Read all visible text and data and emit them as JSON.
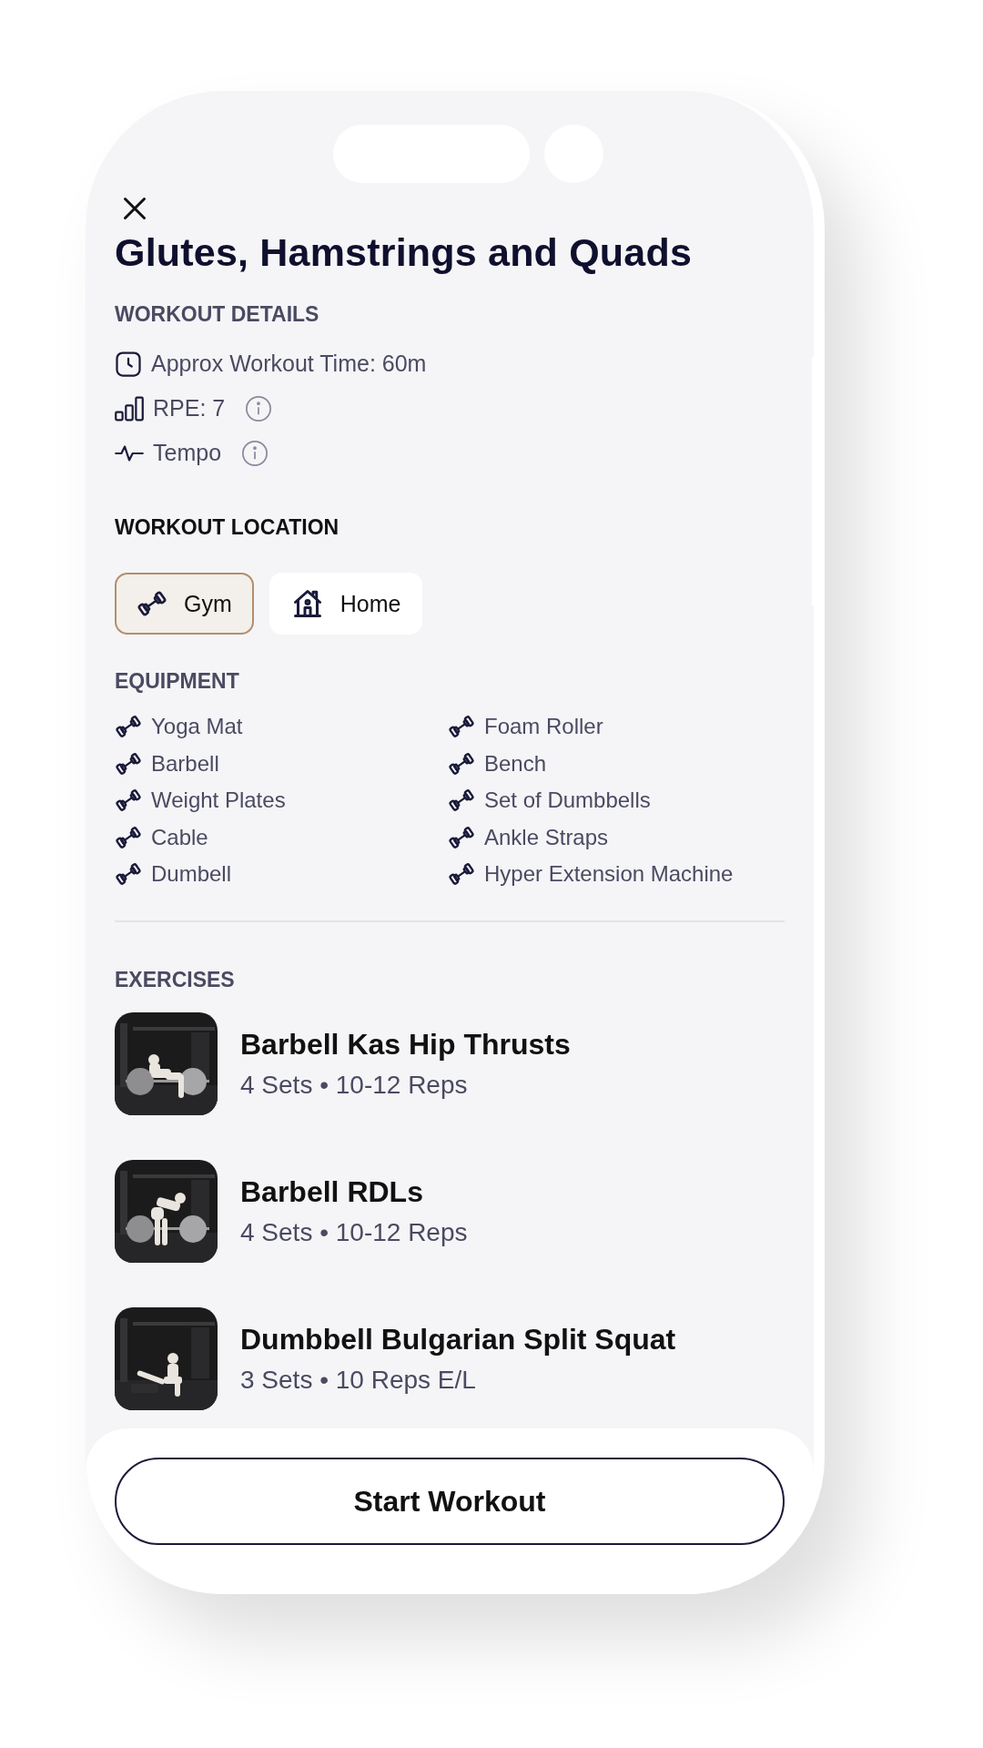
{
  "title": "Glutes, Hamstrings and Quads",
  "details": {
    "heading": "WORKOUT DETAILS",
    "items": [
      {
        "kind": "time",
        "text": "Approx Workout Time: 60m",
        "info": false
      },
      {
        "kind": "rpe",
        "text": "RPE: 7",
        "info": true
      },
      {
        "kind": "tempo",
        "text": "Tempo",
        "info": true
      }
    ]
  },
  "location": {
    "heading": "WORKOUT LOCATION",
    "options": [
      {
        "kind": "gym",
        "label": "Gym",
        "selected": true
      },
      {
        "kind": "home",
        "label": "Home",
        "selected": false
      }
    ]
  },
  "equipment": {
    "heading": "EQUIPMENT",
    "items": [
      "Yoga Mat",
      "Foam Roller",
      "Barbell",
      "Bench",
      "Weight Plates",
      "Set of Dumbbells",
      "Cable",
      "Ankle Straps",
      "Dumbell",
      "Hyper Extension Machine"
    ]
  },
  "exercises": {
    "heading": "EXERCISES",
    "items": [
      {
        "name": "Barbell Kas Hip Thrusts",
        "detail": "4 Sets • 10-12 Reps"
      },
      {
        "name": "Barbell RDLs",
        "detail": "4 Sets • 10-12 Reps"
      },
      {
        "name": "Dumbbell Bulgarian Split Squat",
        "detail": "3 Sets • 10 Reps E/L"
      }
    ]
  },
  "start_button": {
    "label": "Start Workout"
  }
}
